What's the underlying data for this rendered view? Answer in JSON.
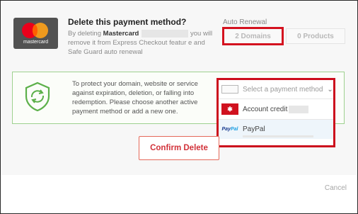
{
  "header": {
    "title": "Delete this payment method?",
    "card_brand": "mastercard",
    "desc_prefix": "By deleting",
    "desc_bold": "Mastercard",
    "desc_suffix": "you will remove it from Express Checkout featur e and Safe Guard auto renewal"
  },
  "auto_renewal": {
    "label": "Auto Renewal",
    "domains_button": "2 Domains",
    "products_button": "0 Products"
  },
  "notice": {
    "text": "To protect your domain, website or service against expiration, deletion, or falling into redemption. Please choose another active payment method or add a new one."
  },
  "dropdown": {
    "placeholder": "Select a payment method",
    "options": [
      {
        "label": "Account credit",
        "icon": "account-credit-icon"
      },
      {
        "label": "PayPal",
        "icon": "paypal-icon"
      }
    ]
  },
  "actions": {
    "confirm_label": "Confirm Delete",
    "cancel_label": "Cancel"
  },
  "colors": {
    "highlight_red": "#cc0f1d",
    "notice_border": "#9ed18f",
    "confirm_text": "#d2323a",
    "paypal_row_bg": "#eef5fb"
  }
}
